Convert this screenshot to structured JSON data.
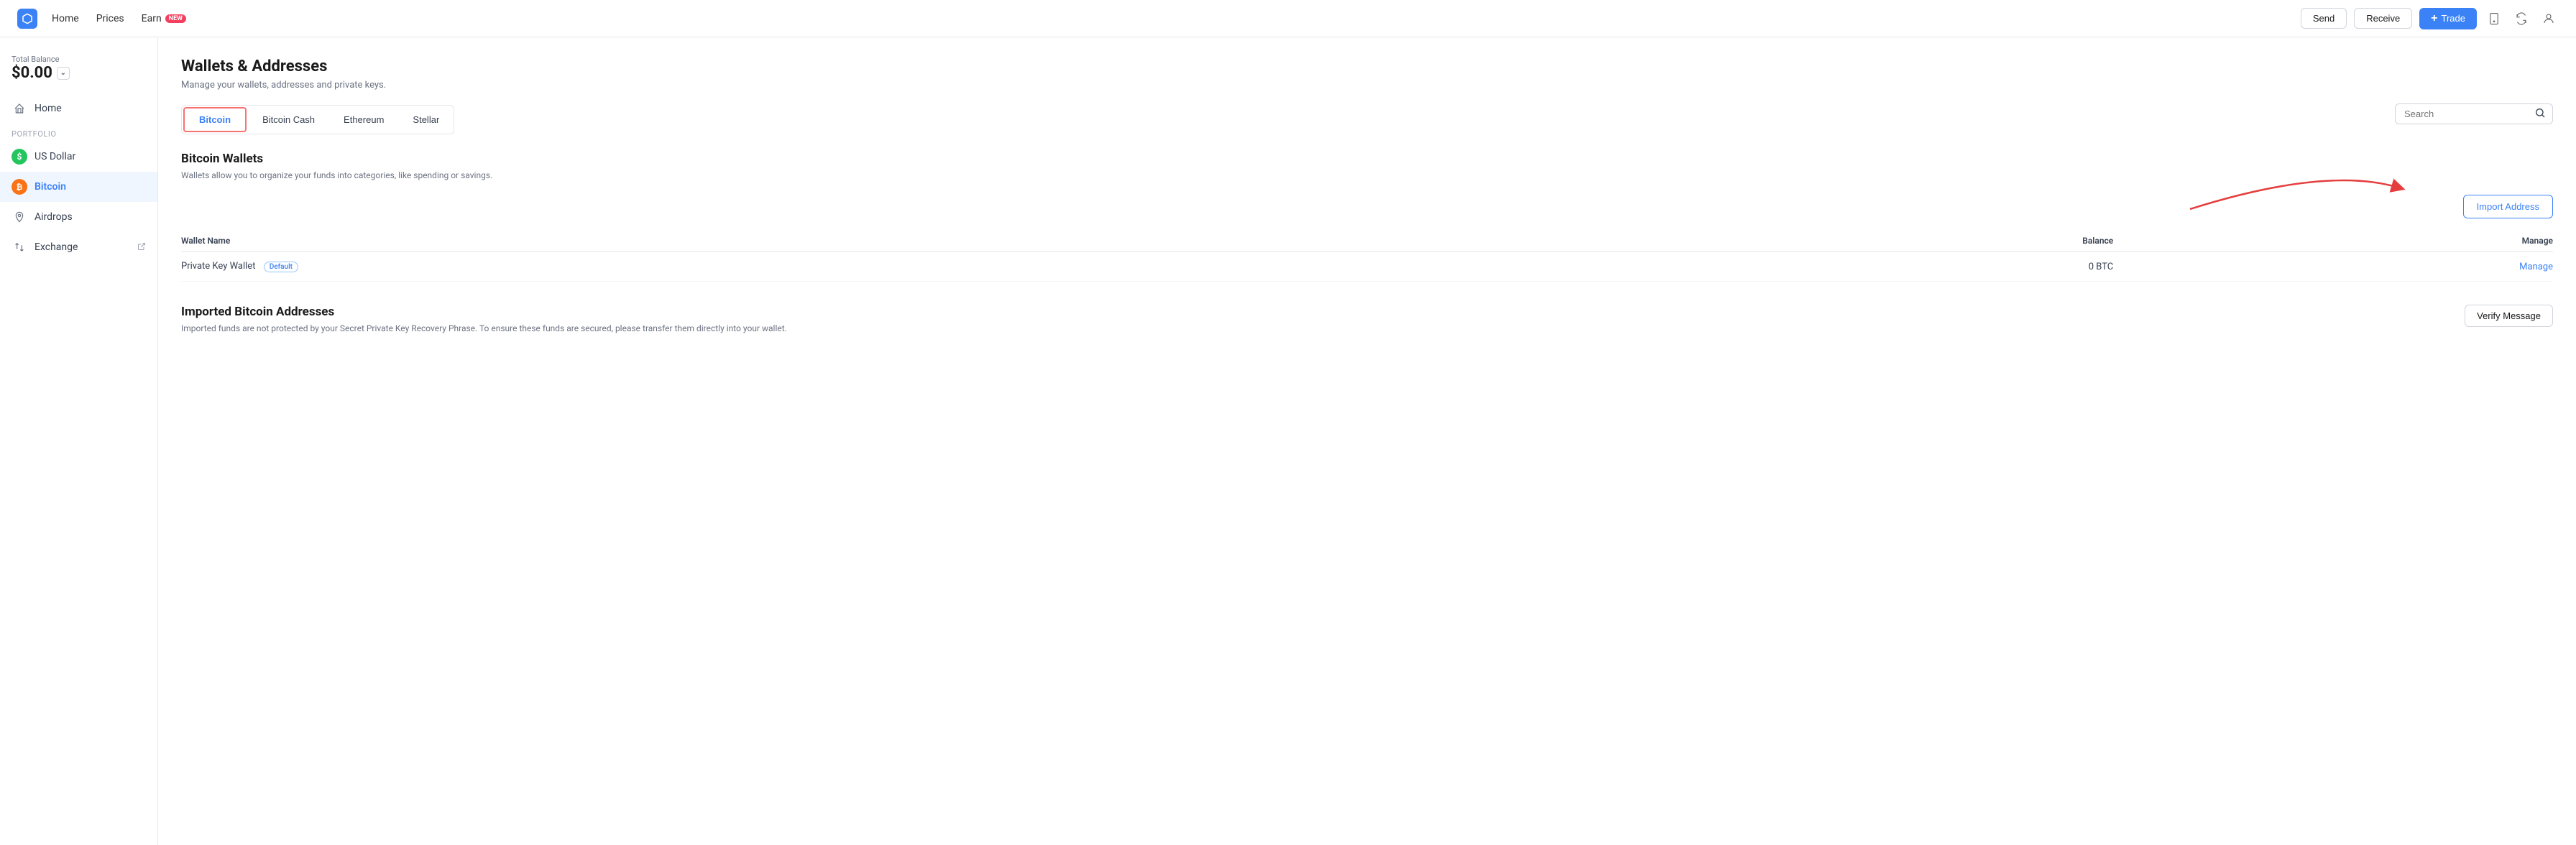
{
  "topnav": {
    "logo_alt": "Blockchain Logo",
    "links": [
      {
        "id": "home",
        "label": "Home"
      },
      {
        "id": "prices",
        "label": "Prices"
      },
      {
        "id": "earn",
        "label": "Earn",
        "badge": "NEW"
      }
    ],
    "actions": {
      "send": "Send",
      "receive": "Receive",
      "trade": "Trade"
    }
  },
  "sidebar": {
    "balance_label": "Total Balance",
    "balance_amount": "$0.00",
    "portfolio_label": "Portfolio",
    "items": [
      {
        "id": "home",
        "label": "Home",
        "icon": "home"
      },
      {
        "id": "usd",
        "label": "US Dollar",
        "icon": "usd"
      },
      {
        "id": "btc",
        "label": "Bitcoin",
        "icon": "btc"
      },
      {
        "id": "airdrops",
        "label": "Airdrops",
        "icon": "airdrop"
      },
      {
        "id": "exchange",
        "label": "Exchange",
        "icon": "exchange",
        "external": true
      }
    ]
  },
  "main": {
    "page_title": "Wallets & Addresses",
    "page_subtitle": "Manage your wallets, addresses and private keys.",
    "tabs": [
      {
        "id": "bitcoin",
        "label": "Bitcoin",
        "active": true
      },
      {
        "id": "bitcoin-cash",
        "label": "Bitcoin Cash",
        "active": false
      },
      {
        "id": "ethereum",
        "label": "Ethereum",
        "active": false
      },
      {
        "id": "stellar",
        "label": "Stellar",
        "active": false
      }
    ],
    "search_placeholder": "Search",
    "section_title": "Bitcoin Wallets",
    "section_subtitle": "Wallets allow you to organize your funds into categories, like spending or savings.",
    "import_btn": "Import Address",
    "table": {
      "col_name": "Wallet Name",
      "col_balance": "Balance",
      "col_manage": "Manage",
      "rows": [
        {
          "name": "Private Key Wallet",
          "badge": "Default",
          "balance": "0 BTC",
          "manage": "Manage"
        }
      ]
    },
    "imported_section_title": "Imported Bitcoin Addresses",
    "imported_section_subtitle": "Imported funds are not protected by your Secret Private Key Recovery Phrase. To ensure these funds are secured, please transfer them directly into your wallet.",
    "verify_btn": "Verify Message"
  }
}
